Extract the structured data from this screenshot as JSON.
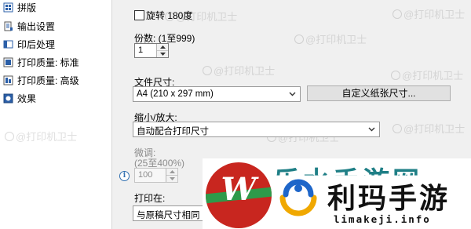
{
  "sidebar": {
    "items": [
      {
        "label": "拼版",
        "icon": "layout-icon"
      },
      {
        "label": "输出设置",
        "icon": "output-settings-icon"
      },
      {
        "label": "印后处理",
        "icon": "post-processing-icon"
      },
      {
        "label": "打印质量: 标准",
        "icon": "print-quality-icon"
      },
      {
        "label": "打印质量: 高级",
        "icon": "print-quality-advanced-icon"
      },
      {
        "label": "效果",
        "icon": "effect-icon"
      }
    ]
  },
  "main": {
    "rotate_label": "旋转 180度",
    "copies_label": "份数: (1至999)",
    "copies_value": "1",
    "paper_size_label": "文件尺寸:",
    "paper_size_value": "A4 (210 x 297 mm)",
    "custom_size_button": "自定义纸张尺寸...",
    "scale_label": "缩小/放大:",
    "scale_value": "自动配合打印尺寸",
    "fine_tune_label": "微调:",
    "fine_tune_range": "(25至400%)",
    "fine_tune_value": "100",
    "print_on_label": "打印在:",
    "print_on_value": "与原稿尺寸相同"
  },
  "watermark_text": "@打印机卫士",
  "overlay": {
    "logo_letter": "W",
    "brand_name": "利玛手游",
    "brand_url": "limakeji.info",
    "ghost_text": "乐水手游网"
  },
  "colors": {
    "logo_red": "#c8261f",
    "logo_green": "#2e9a4a",
    "ghost_teal": "#1f7f86",
    "info_blue": "#2f6fb0"
  }
}
